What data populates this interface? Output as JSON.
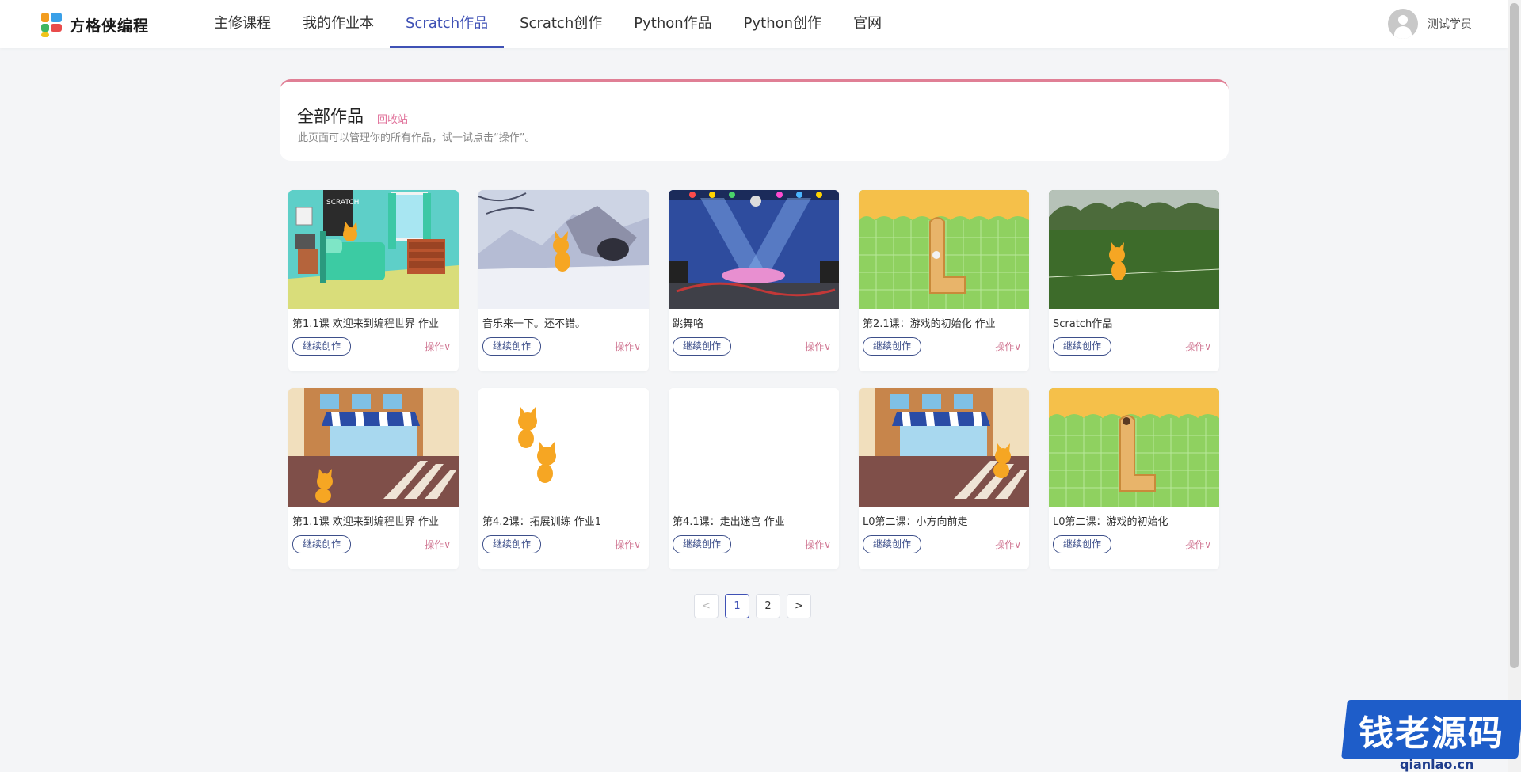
{
  "brand": {
    "name": "方格侠编程"
  },
  "nav": {
    "items": [
      {
        "label": "主修课程",
        "active": false
      },
      {
        "label": "我的作业本",
        "active": false
      },
      {
        "label": "Scratch作品",
        "active": true
      },
      {
        "label": "Scratch创作",
        "active": false
      },
      {
        "label": "Python作品",
        "active": false
      },
      {
        "label": "Python创作",
        "active": false
      },
      {
        "label": "官网",
        "active": false
      }
    ]
  },
  "user": {
    "name": "测试学员"
  },
  "header": {
    "title": "全部作品",
    "recycle_link": "回收站",
    "subtitle": "此页面可以管理你的所有作品，试一试点击“操作”。"
  },
  "cards": [
    {
      "title": "第1.1课 欢迎来到编程世界 作业",
      "thumb": "bedroom",
      "continue": "继续创作",
      "ops": "操作∨"
    },
    {
      "title": "音乐来一下。还不错。",
      "thumb": "snow",
      "continue": "继续创作",
      "ops": "操作∨"
    },
    {
      "title": "跳舞咯",
      "thumb": "stage",
      "continue": "继续创作",
      "ops": "操作∨"
    },
    {
      "title": "第2.1课：游戏的初始化 作业",
      "thumb": "grid",
      "continue": "继续创作",
      "ops": "操作∨"
    },
    {
      "title": "Scratch作品",
      "thumb": "field",
      "continue": "继续创作",
      "ops": "操作∨"
    },
    {
      "title": "第1.1课 欢迎来到编程世界 作业",
      "thumb": "street",
      "continue": "继续创作",
      "ops": "操作∨"
    },
    {
      "title": "第4.2课：拓展训练 作业1",
      "thumb": "two-cats",
      "continue": "继续创作",
      "ops": "操作∨"
    },
    {
      "title": "第4.1课：走出迷宫 作业",
      "thumb": "blank",
      "continue": "继续创作",
      "ops": "操作∨"
    },
    {
      "title": "L0第二课：小方向前走",
      "thumb": "street",
      "continue": "继续创作",
      "ops": "操作∨"
    },
    {
      "title": "L0第二课：游戏的初始化",
      "thumb": "grid",
      "continue": "继续创作",
      "ops": "操作∨"
    }
  ],
  "pagination": {
    "prev": "<",
    "pages": [
      "1",
      "2"
    ],
    "current": "1",
    "next": ">"
  },
  "watermark": {
    "text": "钱老源码",
    "url": "qianlao.cn"
  },
  "colors": {
    "accent": "#3f51b5",
    "ops": "#d07692",
    "panel_border": "#e07f95",
    "watermark": "#1e5dc9"
  }
}
